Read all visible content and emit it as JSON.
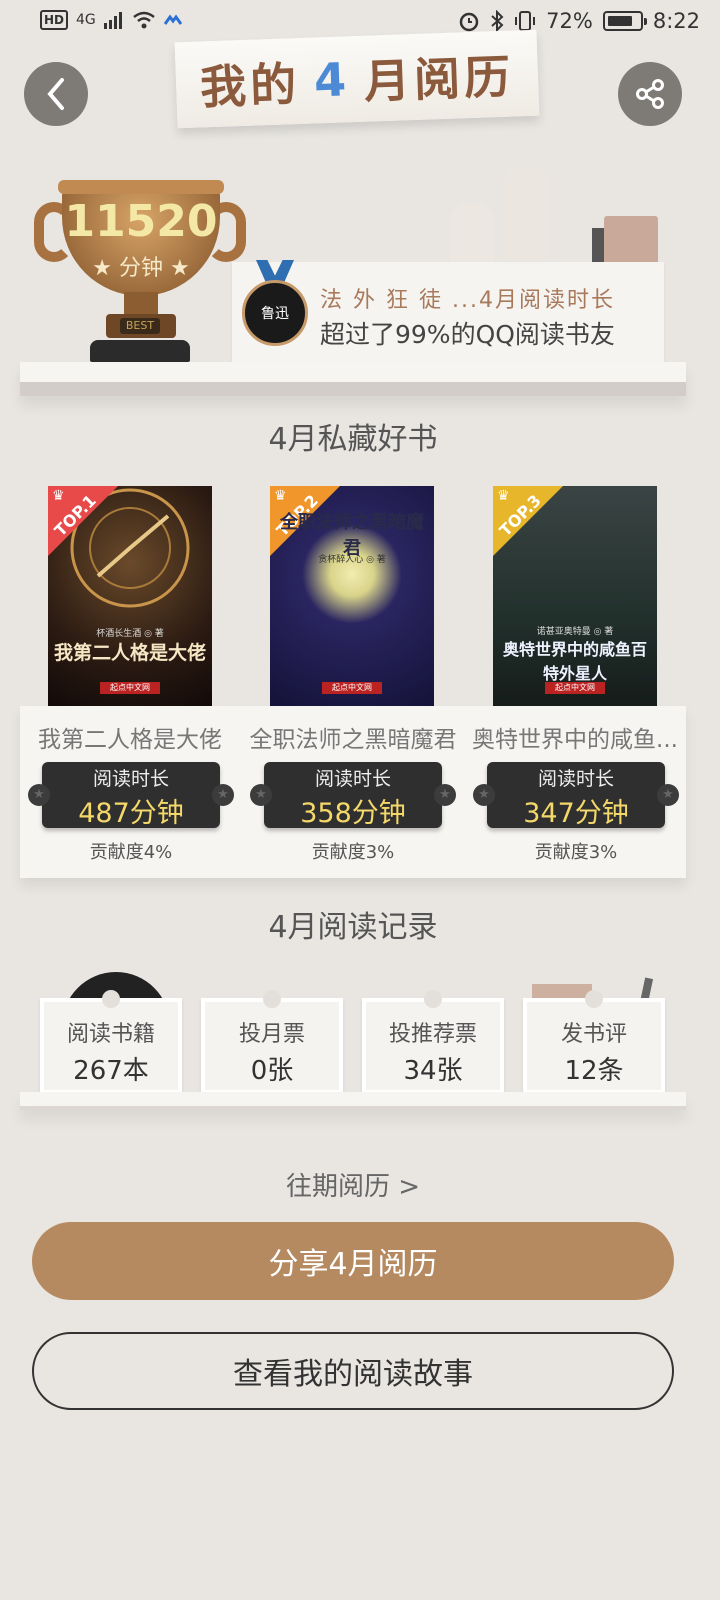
{
  "status_bar": {
    "left_badges": [
      "HD",
      "4G"
    ],
    "battery_percent": "72%",
    "time": "8:22",
    "icons": [
      "signal-icon",
      "wifi-icon",
      "alarm-icon",
      "bluetooth-icon",
      "vibrate-icon",
      "battery-icon"
    ]
  },
  "header": {
    "title_pre": "我的",
    "title_month": "4",
    "title_post": "月阅历"
  },
  "trophy": {
    "minutes": "11520",
    "unit": "分钟",
    "badge": "BEST"
  },
  "rank": {
    "medal_label": "鲁迅",
    "line1": "法 外 狂 徒 ...4月阅读时长",
    "line2": "超过了99%的QQ阅读书友"
  },
  "favorites": {
    "title": "4月私藏好书",
    "books": [
      {
        "top": "TOP.1",
        "corner_color": "#e84a4a",
        "cover_title": "我第二人格是大佬",
        "cover_author": "杯酒长生酒 ◎ 著",
        "publisher": "起点中文网",
        "name": "我第二人格是大佬",
        "time_label": "阅读时长",
        "time_value": "487分钟",
        "contribution": "贡献度4%"
      },
      {
        "top": "TOP.2",
        "corner_color": "#f0962a",
        "cover_title": "全职法师之黑暗魔君",
        "cover_author": "贪杯醉人心 ◎ 著",
        "publisher": "起点中文网",
        "name": "全职法师之黑暗魔君",
        "time_label": "阅读时长",
        "time_value": "358分钟",
        "contribution": "贡献度3%"
      },
      {
        "top": "TOP.3",
        "corner_color": "#e8b62a",
        "cover_title": "奥特世界中的咸鱼百特外星人",
        "cover_author": "诺甚亚奥特曼 ◎ 著",
        "publisher": "起点中文网",
        "name": "奥特世界中的咸鱼...",
        "time_label": "阅读时长",
        "time_value": "347分钟",
        "contribution": "贡献度3%"
      }
    ]
  },
  "records": {
    "title": "4月阅读记录",
    "stats": [
      {
        "label": "阅读书籍",
        "value": "267本"
      },
      {
        "label": "投月票",
        "value": "0张"
      },
      {
        "label": "投推荐票",
        "value": "34张"
      },
      {
        "label": "发书评",
        "value": "12条"
      }
    ]
  },
  "history_link": "往期阅历 >",
  "buttons": {
    "share": "分享4月阅历",
    "story": "查看我的阅读故事"
  }
}
